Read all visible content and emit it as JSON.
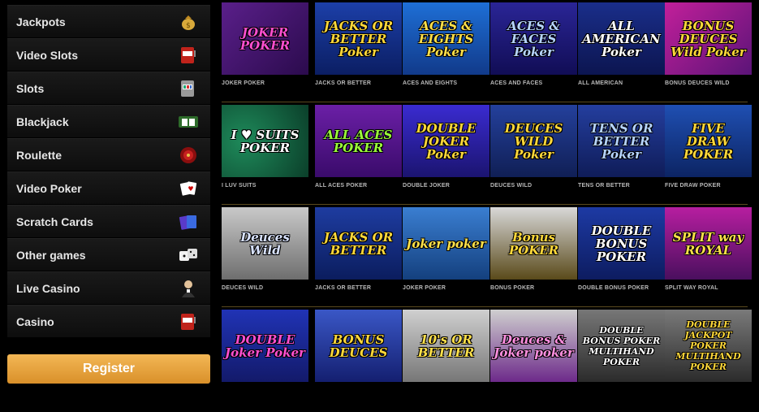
{
  "sidebar": {
    "items": [
      {
        "label": "Jackpots",
        "icon": "money-bag-icon"
      },
      {
        "label": "Video Slots",
        "icon": "slot-machine-icon"
      },
      {
        "label": "Slots",
        "icon": "slot-reels-icon"
      },
      {
        "label": "Blackjack",
        "icon": "blackjack-table-icon"
      },
      {
        "label": "Roulette",
        "icon": "roulette-wheel-icon"
      },
      {
        "label": "Video Poker",
        "icon": "playing-cards-icon"
      },
      {
        "label": "Scratch Cards",
        "icon": "scratch-cards-icon"
      },
      {
        "label": "Other games",
        "icon": "dice-icon"
      },
      {
        "label": "Live Casino",
        "icon": "dealer-icon"
      },
      {
        "label": "Casino",
        "icon": "slot-machine-icon"
      }
    ]
  },
  "register_label": "Register",
  "games": {
    "rows": [
      [
        {
          "thumb": "JOKER POKER",
          "caption": "JOKER POKER",
          "color": "#ff4fd0"
        },
        {
          "thumb": "JACKS OR BETTER Poker",
          "caption": "JACKS OR BETTER",
          "color": "#ffd83a"
        },
        {
          "thumb": "ACES & EIGHTS Poker",
          "caption": "ACES AND EIGHTS",
          "color": "#ffe14a"
        },
        {
          "thumb": "ACES & FACES Poker",
          "caption": "ACES AND FACES",
          "color": "#b6d4ff"
        },
        {
          "thumb": "ALL AMERICAN Poker",
          "caption": "ALL AMERICAN",
          "color": "#ffffff"
        },
        {
          "thumb": "BONUS DEUCES Wild Poker",
          "caption": "BONUS DEUCES WILD",
          "color": "#ffd83a"
        }
      ],
      [
        {
          "thumb": "I ♥ SUITS POKER",
          "caption": "I LUV SUITS",
          "color": "#ffffff"
        },
        {
          "thumb": "ALL ACES POKER",
          "caption": "ALL ACES POKER",
          "color": "#9cff3a"
        },
        {
          "thumb": "DOUBLE JOKER Poker",
          "caption": "DOUBLE JOKER",
          "color": "#ffd83a"
        },
        {
          "thumb": "DEUCES WILD Poker",
          "caption": "DEUCES WILD",
          "color": "#ffd83a"
        },
        {
          "thumb": "TENS OR BETTER Poker",
          "caption": "TENS OR BETTER",
          "color": "#b6d4ff"
        },
        {
          "thumb": "FIVE DRAW POKER",
          "caption": "FIVE DRAW POKER",
          "color": "#ffd83a"
        }
      ],
      [
        {
          "thumb": "Deuces Wild",
          "caption": "DEUCES WILD",
          "color": "#d8e2ff"
        },
        {
          "thumb": "JACKS OR BETTER",
          "caption": "JACKS OR BETTER",
          "color": "#ffd83a"
        },
        {
          "thumb": "Joker poker",
          "caption": "JOKER POKER",
          "color": "#ffe14a"
        },
        {
          "thumb": "Bonus POKER",
          "caption": "BONUS POKER",
          "color": "#ffd83a"
        },
        {
          "thumb": "DOUBLE BONUS POKER",
          "caption": "DOUBLE BONUS POKER",
          "color": "#ffffff"
        },
        {
          "thumb": "SPLIT way ROYAL",
          "caption": "SPLIT WAY ROYAL",
          "color": "#ffe14a"
        }
      ],
      [
        {
          "thumb": "DOUBLE Joker Poker",
          "caption": "",
          "color": "#ff4fd0"
        },
        {
          "thumb": "BONUS DEUCES",
          "caption": "",
          "color": "#ffd83a"
        },
        {
          "thumb": "10's OR BETTER",
          "caption": "",
          "color": "#ffe14a"
        },
        {
          "thumb": "Deuces & Joker poker",
          "caption": "",
          "color": "#ff8fe0"
        },
        {
          "thumb": "DOUBLE BONUS POKER MULTIHAND POKER",
          "caption": "",
          "color": "#ffffff"
        },
        {
          "thumb": "DOUBLE JACKPOT POKER MULTIHAND POKER",
          "caption": "",
          "color": "#ffd83a"
        }
      ]
    ]
  }
}
